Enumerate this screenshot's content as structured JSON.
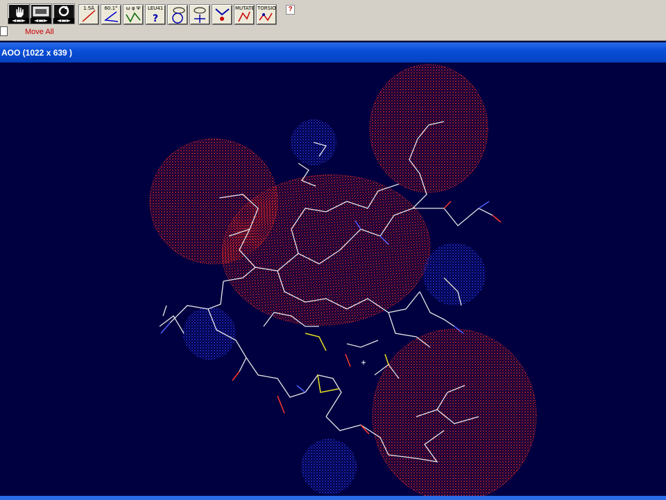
{
  "toolbar": {
    "buttons": [
      {
        "icon": "hand-move-icon",
        "label": ""
      },
      {
        "icon": "screen-move-icon",
        "label": ""
      },
      {
        "icon": "rotate-icon",
        "label": ""
      },
      {
        "icon": "distance-icon",
        "label": "1.5Å"
      },
      {
        "icon": "angle-icon",
        "label": "60.1°"
      },
      {
        "icon": "dihedral-icon",
        "label": "ω φ Ψ"
      },
      {
        "icon": "residue-id-icon",
        "label": "LEU41"
      },
      {
        "icon": "neighbors-icon",
        "label": ""
      },
      {
        "icon": "center-icon",
        "label": ""
      },
      {
        "icon": "fit-icon",
        "label": ""
      },
      {
        "icon": "mutate-icon",
        "label": "MUTATE"
      },
      {
        "icon": "torsion-icon",
        "label": "TORSION"
      }
    ],
    "tool_status": "Move All",
    "help_label": "?"
  },
  "window": {
    "title": "AOO  (1022 x 639 )"
  },
  "colors": {
    "background": "#000040",
    "acidic_surface": "#ff2a1a",
    "basic_surface": "#2a3cff",
    "bonds": "#e8e8e8"
  }
}
